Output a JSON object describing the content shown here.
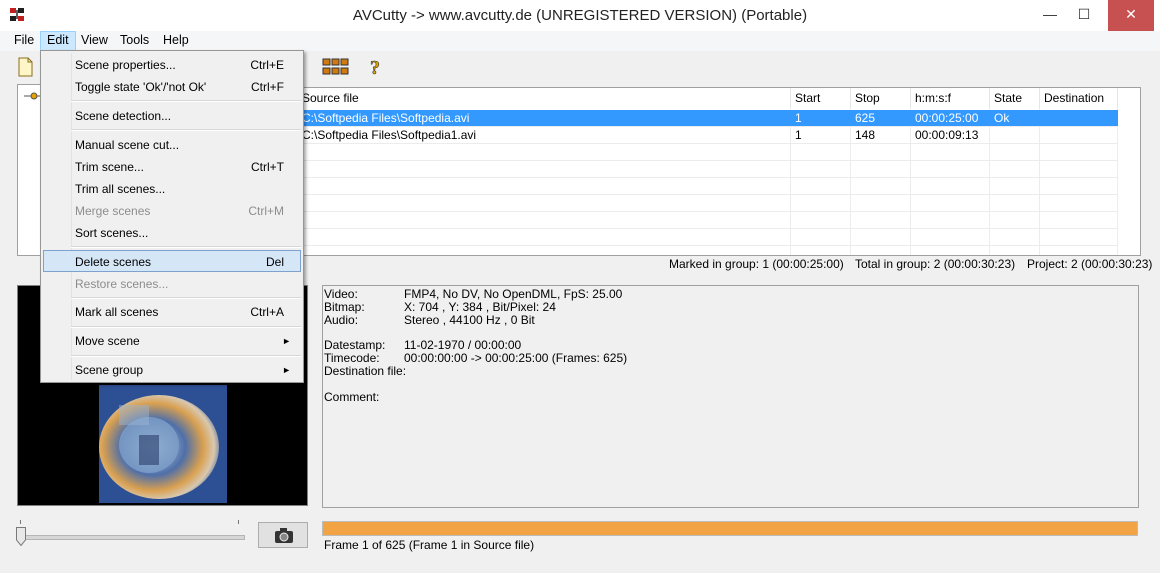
{
  "window": {
    "title": "AVCutty -> www.avcutty.de (UNREGISTERED VERSION) (Portable)",
    "minimize": "—",
    "maximize": "☐",
    "close": "✕"
  },
  "menubar": [
    "File",
    "Edit",
    "View",
    "Tools",
    "Help"
  ],
  "edit_menu": [
    {
      "label": "Scene properties...",
      "shortcut": "Ctrl+E"
    },
    {
      "label": "Toggle state 'Ok'/'not Ok'",
      "shortcut": "Ctrl+F"
    },
    {
      "label": "Scene detection..."
    },
    {
      "label": "Manual scene cut..."
    },
    {
      "label": "Trim scene...",
      "shortcut": "Ctrl+T"
    },
    {
      "label": "Trim all scenes..."
    },
    {
      "label": "Merge scenes",
      "shortcut": "Ctrl+M"
    },
    {
      "label": "Sort scenes..."
    },
    {
      "label": "Delete scenes",
      "shortcut": "Del"
    },
    {
      "label": "Restore scenes..."
    },
    {
      "label": "Mark all scenes",
      "shortcut": "Ctrl+A"
    },
    {
      "label": "Move scene",
      "submenu": "►"
    },
    {
      "label": "Scene group",
      "submenu": "►"
    }
  ],
  "scene_list": {
    "columns": [
      "Source file",
      "Start",
      "Stop",
      "h:m:s:f",
      "State",
      "Destination f..."
    ],
    "rows": [
      {
        "source": "C:\\Softpedia Files\\Softpedia.avi",
        "start": "1",
        "stop": "625",
        "hmsf": "00:00:25:00",
        "state": "Ok",
        "destination": ""
      },
      {
        "source": "C:\\Softpedia Files\\Softpedia1.avi",
        "start": "1",
        "stop": "148",
        "hmsf": "00:00:09:13",
        "state": "",
        "destination": ""
      }
    ]
  },
  "status": {
    "marked": "Marked in group: 1 (00:00:25:00)",
    "total": "Total in group: 2 (00:00:30:23)",
    "project": "Project: 2 (00:00:30:23)"
  },
  "info": {
    "labels": {
      "video": "Video:",
      "bitmap": "Bitmap:",
      "audio": "Audio:",
      "datestamp": "Datestamp:",
      "timecode": "Timecode:",
      "destination": "Destination file:",
      "comment": "Comment:"
    },
    "values": {
      "video": "FMP4, No DV, No OpenDML, FpS: 25.00",
      "bitmap": "X: 704 , Y: 384 , Bit/Pixel: 24",
      "audio": "Stereo , 44100 Hz , 0 Bit",
      "datestamp": "11-02-1970 / 00:00:00",
      "timecode": "00:00:00:00 -> 00:00:25:00 (Frames: 625)"
    }
  },
  "progress": {
    "fraction": 1.0
  },
  "frame_text": "Frame 1 of 625 (Frame 1 in Source file)",
  "colors": {
    "selection": "#3399ff",
    "progress": "#f2a444",
    "close_button": "#c75050"
  }
}
